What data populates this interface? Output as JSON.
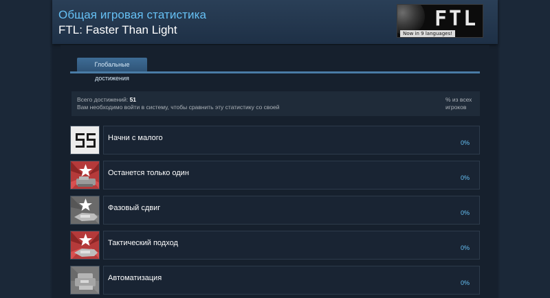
{
  "header": {
    "title": "Общая игровая статистика",
    "game": "FTL: Faster Than Light",
    "logo": {
      "text": "FTL",
      "subtitle": "Now in 9 languages!"
    }
  },
  "tabs": [
    {
      "label": "Глобальные достижения",
      "active": true
    }
  ],
  "summary": {
    "total_label": "Всего достижений:",
    "total_value": "51",
    "login_note": "Вам необходимо войти в систему, чтобы сравнить эту статистику со своей",
    "percent_header": "% из всех игроков"
  },
  "achievements": [
    {
      "name": "Начни с малого",
      "percent": "0%",
      "icon": "pixel-ss-icon"
    },
    {
      "name": "Останется только один",
      "percent": "0%",
      "icon": "red-star-ship-icon"
    },
    {
      "name": "Фазовый сдвиг",
      "percent": "0%",
      "icon": "grey-star-ship-icon"
    },
    {
      "name": "Тактический подход",
      "percent": "0%",
      "icon": "red-star-ship-icon"
    },
    {
      "name": "Автоматизация",
      "percent": "0%",
      "icon": "grey-ship-icon"
    }
  ],
  "colors": {
    "accent": "#66c0f4",
    "background": "#1b2838",
    "tab": "#3e6c95",
    "red_icon": "#b53a3a"
  }
}
